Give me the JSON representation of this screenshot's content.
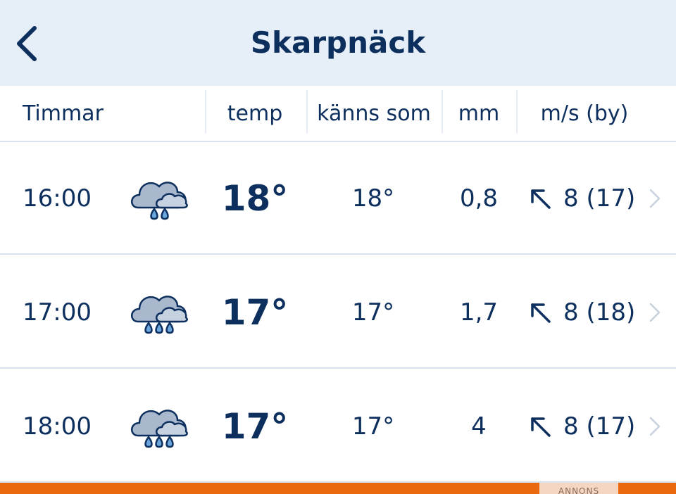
{
  "header": {
    "title": "Skarpnäck",
    "back_icon": "chevron-left-icon"
  },
  "columns": {
    "hours": "Timmar",
    "temp": "temp",
    "feels_like": "känns som",
    "precip": "mm",
    "wind": "m/s (by)"
  },
  "rows": [
    {
      "time": "16:00",
      "icon": "rain-cloud-icon",
      "temp": "18°",
      "feels_like": "18°",
      "precip": "0,8",
      "wind_dir_icon": "arrow-up-left-icon",
      "wind": "8 (17)",
      "drops": 2
    },
    {
      "time": "17:00",
      "icon": "rain-cloud-icon",
      "temp": "17°",
      "feels_like": "17°",
      "precip": "1,7",
      "wind_dir_icon": "arrow-up-left-icon",
      "wind": "8 (18)",
      "drops": 3
    },
    {
      "time": "18:00",
      "icon": "rain-cloud-icon",
      "temp": "17°",
      "feels_like": "17°",
      "precip": "4",
      "wind_dir_icon": "arrow-up-left-icon",
      "wind": "8 (17)",
      "drops": 3
    }
  ],
  "ad": {
    "label": "ANNONS"
  },
  "colors": {
    "accent": "#0d2f5e",
    "topbar": "#e6eff8",
    "ad_bar": "#e8690e"
  }
}
